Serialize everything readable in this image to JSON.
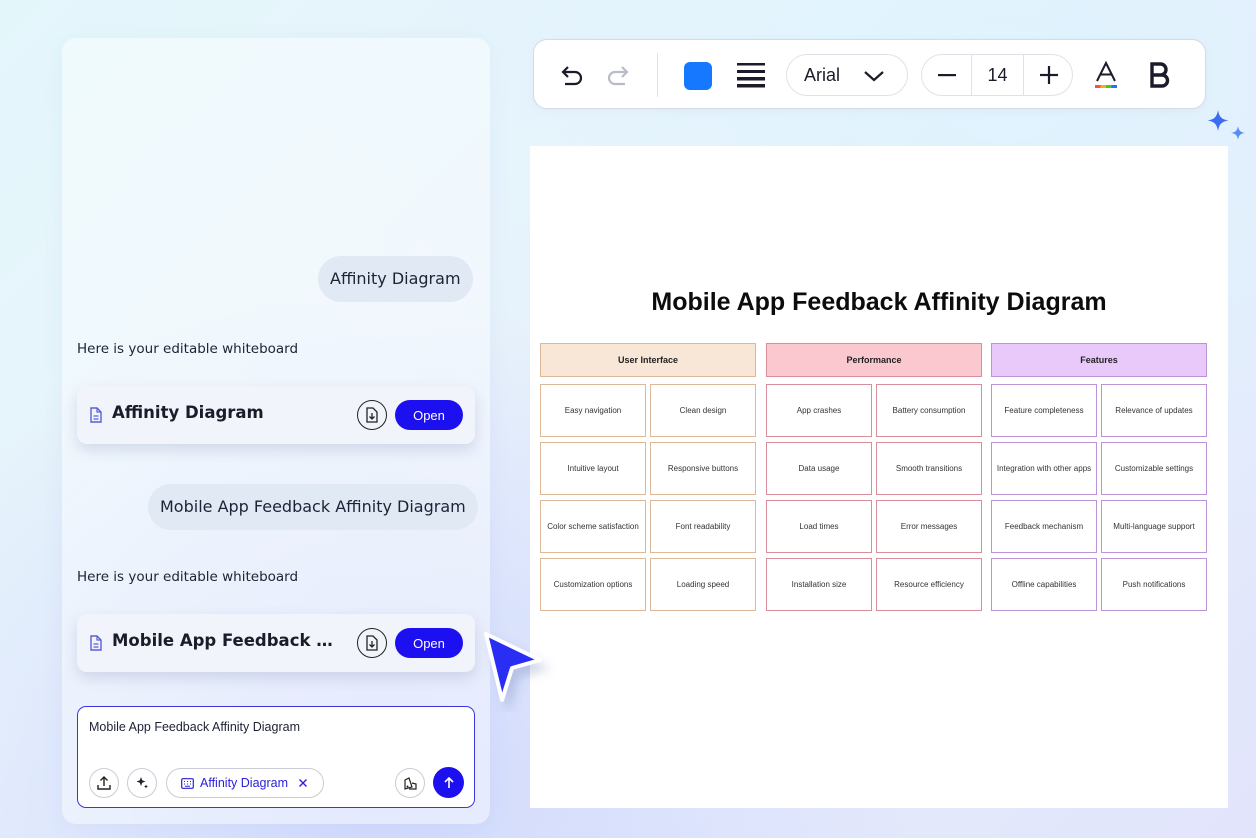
{
  "chat": {
    "messages": [
      {
        "role": "user",
        "text": "Affinity Diagram"
      },
      {
        "role": "bot",
        "text": "Here is your editable whiteboard"
      },
      {
        "role": "user",
        "text": "Mobile App Feedback Affinity Diagram"
      },
      {
        "role": "bot",
        "text": "Here is your editable whiteboard"
      }
    ],
    "cards": [
      {
        "title": "Affinity Diagram",
        "open_label": "Open"
      },
      {
        "title": "Mobile App Feedback Affinity Diagram",
        "open_label": "Open"
      }
    ],
    "input": {
      "value": "Mobile App Feedback Affinity Diagram",
      "chip_label": "Affinity Diagram"
    }
  },
  "toolbar": {
    "fill_color": "#1677ff",
    "font": "Arial",
    "font_size": "14"
  },
  "board": {
    "title": "Mobile App Feedback Affinity Diagram",
    "categories": [
      {
        "name": "User Interface",
        "header_color": "#f8e6d6",
        "border_color": "#ddb99a",
        "notes": [
          "Easy navigation",
          "Clean design",
          "Intuitive layout",
          "Responsive buttons",
          "Color scheme satisfaction",
          "Font readability",
          "Customization options",
          "Loading speed"
        ]
      },
      {
        "name": "Performance",
        "header_color": "#fbc8d0",
        "border_color": "#d98e9b",
        "notes": [
          "App crashes",
          "Battery consumption",
          "Data usage",
          "Smooth transitions",
          "Load times",
          "Error messages",
          "Installation size",
          "Resource efficiency"
        ]
      },
      {
        "name": "Features",
        "header_color": "#e9c9fa",
        "border_color": "#bc93d4",
        "notes": [
          "Feature completeness",
          "Relevance of updates",
          "Integration with other apps",
          "Customizable settings",
          "Feedback mechanism",
          "Multi-language support",
          "Offline capabilities",
          "Push notifications"
        ]
      }
    ]
  }
}
